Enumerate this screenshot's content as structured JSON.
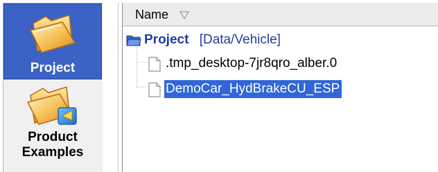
{
  "nav": {
    "items": [
      {
        "label": "Project",
        "icon": "folder-icon",
        "selected": true
      },
      {
        "label": "Product Examples",
        "icon": "folder-with-badge-icon",
        "selected": false
      }
    ]
  },
  "tree": {
    "column_header": "Name",
    "sort_icon": "sort-descending-icon",
    "root": {
      "label": "Project",
      "path": "[Data/Vehicle]",
      "icon": "open-folder-icon"
    },
    "children": [
      {
        "label": ".tmp_desktop-7jr8qro_alber.0",
        "icon": "file-icon",
        "selected": false
      },
      {
        "label": "DemoCar_HydBrakeCU_ESP",
        "icon": "file-icon",
        "selected": true
      }
    ]
  },
  "colors": {
    "selection": "#3166d8",
    "nav_selected_bg": "#3b62c4",
    "link_blue": "#1f3f9e"
  }
}
